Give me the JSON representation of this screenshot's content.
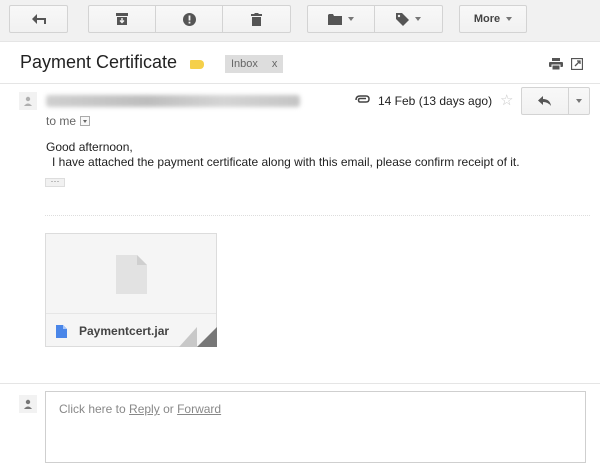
{
  "toolbar": {
    "back_icon": "arrow-left-icon",
    "archive_icon": "archive-icon",
    "spam_icon": "report-spam-icon",
    "delete_icon": "trash-icon",
    "folder_icon": "folder-icon",
    "label_icon": "tag-icon",
    "more_label": "More"
  },
  "email": {
    "subject": "Payment Certificate",
    "label_color": "#f5d04a",
    "inbox_label": "Inbox",
    "inbox_remove": "x",
    "date": "14 Feb (13 days ago)",
    "to": "to me",
    "greeting": "Good afternoon,",
    "body": "I have attached the payment certificate along with this email, please confirm receipt of it.",
    "ellipsis": "···"
  },
  "attachment": {
    "name": "Paymentcert.jar",
    "icon_color": "#4a86e8"
  },
  "reply": {
    "prefix": "Click here to",
    "reply_link": "Reply",
    "or": "or",
    "forward_link": "Forward"
  }
}
